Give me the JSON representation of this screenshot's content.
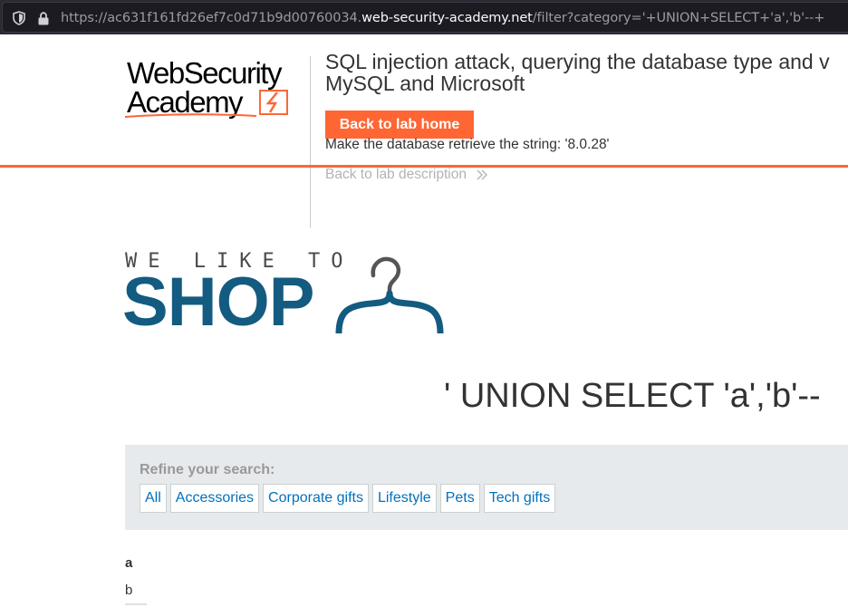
{
  "browser": {
    "url_scheme": "https://",
    "url_subdomain": "ac631f161fd26ef7c0d71b9d00760034.",
    "url_host": "web-security-academy.net",
    "url_path": "/filter?category='+UNION+SELECT+'a','b'--+"
  },
  "lab": {
    "logo_line1": "WebSecurity",
    "logo_line2": "Academy",
    "title_line1": "SQL injection attack, querying the database type and v",
    "title_line2": "MySQL and Microsoft",
    "back_button": "Back to lab home",
    "task": "Make the database retrieve the string: '8.0.28'",
    "description_link": "Back to lab description",
    "accent_color": "#ff6633"
  },
  "shop": {
    "tagline": "WE LIKE TO",
    "word": "SHOP",
    "brand_color": "#135b80"
  },
  "page": {
    "heading": "' UNION SELECT 'a','b'--"
  },
  "filter": {
    "label": "Refine your search:",
    "items": [
      "All",
      "Accessories",
      "Corporate gifts",
      "Lifestyle",
      "Pets",
      "Tech gifts"
    ]
  },
  "results": {
    "first": "a",
    "second": "b"
  }
}
